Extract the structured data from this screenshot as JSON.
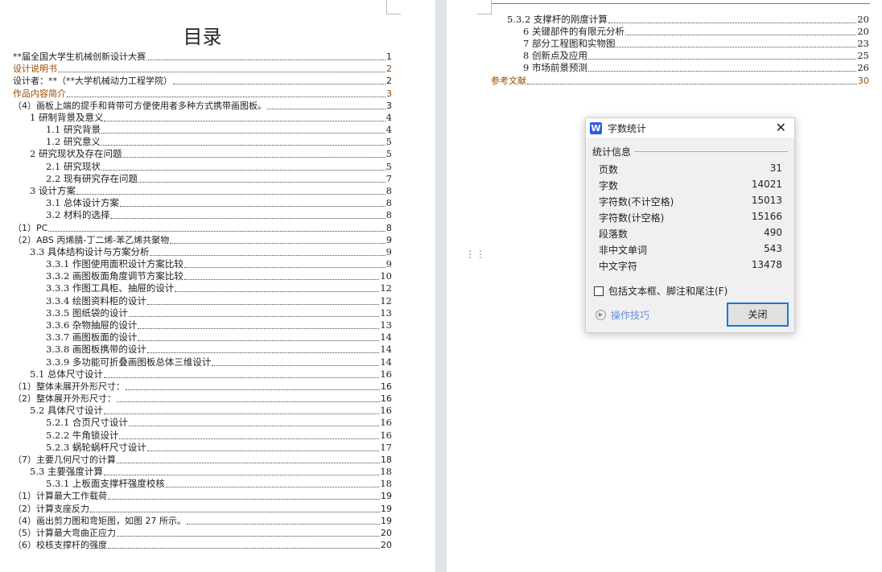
{
  "left_page": {
    "title": "目录",
    "entries": [
      {
        "label": "**届全国大学生机械创新设计大赛",
        "page": "1",
        "level": 0,
        "hd": false
      },
      {
        "label": "设计说明书",
        "page": "2",
        "level": 0,
        "hd": true
      },
      {
        "label": "设计者：**（**大学机械动力工程学院）",
        "page": "2",
        "level": 0,
        "hd": false
      },
      {
        "label": "作品内容简介",
        "page": "3",
        "level": 0,
        "hd": true
      },
      {
        "label": "（4）画板上端的提手和背带可方便使用者多种方式携带画图板。",
        "page": "3",
        "level": 0
      },
      {
        "label": "1 研制背景及意义",
        "page": "4",
        "level": 1
      },
      {
        "label": "1.1 研究背景",
        "page": "4",
        "level": 2
      },
      {
        "label": "1.2 研究意义",
        "page": "5",
        "level": 2
      },
      {
        "label": "2 研究现状及存在问题",
        "page": "5",
        "level": 1
      },
      {
        "label": "2.1 研究现状",
        "page": "5",
        "level": 2
      },
      {
        "label": "2.2 现有研究存在问题",
        "page": "7",
        "level": 2
      },
      {
        "label": "3 设计方案",
        "page": "8",
        "level": 1
      },
      {
        "label": "3.1 总体设计方案",
        "page": "8",
        "level": 2
      },
      {
        "label": "3.2 材料的选择",
        "page": "8",
        "level": 2
      },
      {
        "label": "（1）PC",
        "page": "8",
        "level": 0
      },
      {
        "label": "（2）ABS 丙烯腈-丁二烯-苯乙烯共聚物",
        "page": "9",
        "level": 0
      },
      {
        "label": "3.3 具体结构设计与方案分析",
        "page": "9",
        "level": 1
      },
      {
        "label": "3.3.1 作图使用面积设计方案比较",
        "page": "9",
        "level": 2
      },
      {
        "label": "3.3.2 画图板面角度调节方案比较",
        "page": "10",
        "level": 2
      },
      {
        "label": "3.3.3 作图工具柜、抽屉的设计",
        "page": "12",
        "level": 2
      },
      {
        "label": "3.3.4 绘图资料柜的设计",
        "page": "12",
        "level": 2
      },
      {
        "label": "3.3.5 图纸袋的设计",
        "page": "13",
        "level": 2
      },
      {
        "label": "3.3.6 杂物抽屉的设计",
        "page": "13",
        "level": 2
      },
      {
        "label": "3.3.7 画图板面的设计",
        "page": "14",
        "level": 2
      },
      {
        "label": "3.3.8 画图板携带的设计",
        "page": "14",
        "level": 2
      },
      {
        "label": "3.3.9 多功能可折叠画图板总体三维设计",
        "page": "14",
        "level": 2
      },
      {
        "label": "5.1 总体尺寸设计",
        "page": "16",
        "level": 1
      },
      {
        "label": "（1）整体未展开外形尺寸：",
        "page": "16",
        "level": 0
      },
      {
        "label": "（2）整体展开外形尺寸：",
        "page": "16",
        "level": 0
      },
      {
        "label": "5.2 具体尺寸设计",
        "page": "16",
        "level": 1
      },
      {
        "label": "5.2.1 合页尺寸设计",
        "page": "16",
        "level": 2
      },
      {
        "label": "5.2.2 牛角锁设计",
        "page": "16",
        "level": 2
      },
      {
        "label": "5.2.3 蜗轮蜗杆尺寸设计",
        "page": "17",
        "level": 2
      },
      {
        "label": "（7）主要几何尺寸的计算",
        "page": "18",
        "level": 0
      },
      {
        "label": "5.3 主要强度计算",
        "page": "18",
        "level": 1
      },
      {
        "label": "5.3.1 上板面支撑杆强度校核",
        "page": "18",
        "level": 2
      },
      {
        "label": "（1）计算最大工作载荷",
        "page": "19",
        "level": 0
      },
      {
        "label": "（2）计算支座反力",
        "page": "19",
        "level": 0
      },
      {
        "label": "（4）画出剪力图和弯矩图，如图 27 所示。",
        "page": "19",
        "level": 0
      },
      {
        "label": "（5）计算最大弯曲正应力",
        "page": "20",
        "level": 0
      },
      {
        "label": "（6）校核支撑杆的强度",
        "page": "20",
        "level": 0
      }
    ]
  },
  "right_page": {
    "entries": [
      {
        "label": "5.3.2 支撑杆的刚度计算",
        "page": "20",
        "level": 1
      },
      {
        "label": "6 关键部件的有限元分析",
        "page": "20",
        "level": 2
      },
      {
        "label": "7 部分工程图和实物图",
        "page": "23",
        "level": 2
      },
      {
        "label": "8 创新点及应用",
        "page": "25",
        "level": 2
      },
      {
        "label": "9 市场前景预测",
        "page": "26",
        "level": 2
      },
      {
        "label": "参考文献",
        "page": "30",
        "level": 0,
        "hd": true
      }
    ]
  },
  "dialog": {
    "app_icon": "W",
    "title": "字数统计",
    "group_label": "统计信息",
    "stats": [
      {
        "label": "页数",
        "value": "31"
      },
      {
        "label": "字数",
        "value": "14021"
      },
      {
        "label": "字符数(不计空格)",
        "value": "15013"
      },
      {
        "label": "字符数(计空格)",
        "value": "15166"
      },
      {
        "label": "段落数",
        "value": "490"
      },
      {
        "label": "非中文单词",
        "value": "543"
      },
      {
        "label": "中文字符",
        "value": "13478"
      }
    ],
    "checkbox_label": "包括文本框、脚注和尾注(F)",
    "checkbox_checked": false,
    "tips_label": "操作技巧",
    "close_button": "关闭"
  }
}
